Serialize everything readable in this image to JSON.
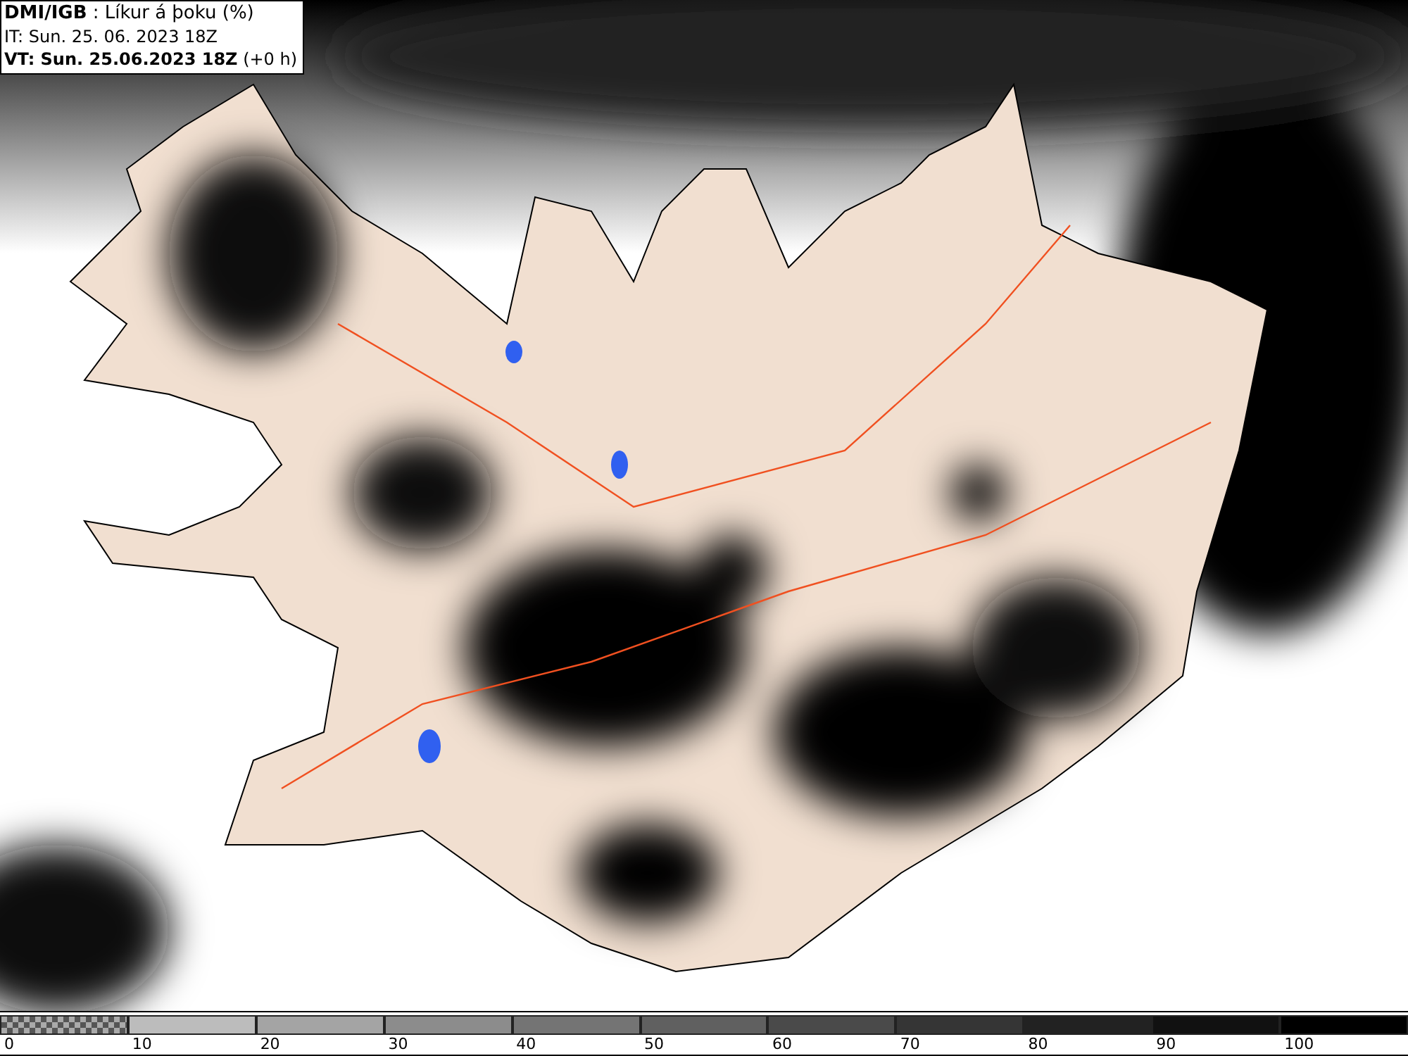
{
  "header": {
    "lines": [
      "**DMI/IGB** : Líkur á þoku (%)",
      "IT: Sun. 25. 06. 2023 18Z",
      "**VT: Sun. 25.06.2023 18Z** (+0 h)"
    ]
  },
  "legend": {
    "segments": [
      {
        "kind": "checker"
      },
      {
        "kind": "solid",
        "color": "#bcbcbc"
      },
      {
        "kind": "solid",
        "color": "#a4a4a4"
      },
      {
        "kind": "solid",
        "color": "#8c8c8c"
      },
      {
        "kind": "solid",
        "color": "#747474"
      },
      {
        "kind": "solid",
        "color": "#606060"
      },
      {
        "kind": "solid",
        "color": "#4a4a4a"
      },
      {
        "kind": "solid",
        "color": "#353535"
      },
      {
        "kind": "solid",
        "color": "#222222"
      },
      {
        "kind": "solid",
        "color": "#111111"
      },
      {
        "kind": "solid",
        "color": "#000000"
      }
    ],
    "labels": [
      "0",
      "10",
      "20",
      "30",
      "40",
      "50",
      "60",
      "70",
      "80",
      "90",
      "100"
    ]
  }
}
